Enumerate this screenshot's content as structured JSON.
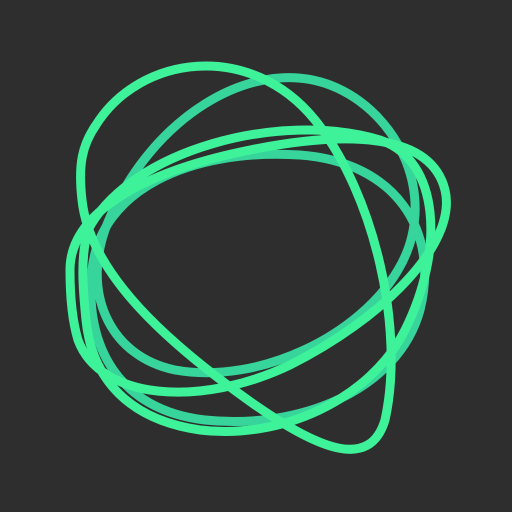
{
  "background_color": "#2e2e2e",
  "logo": {
    "icon": "looping-rings-logo-icon",
    "colors": {
      "primary": "#3ef29a",
      "secondary": "#37d49b"
    }
  }
}
